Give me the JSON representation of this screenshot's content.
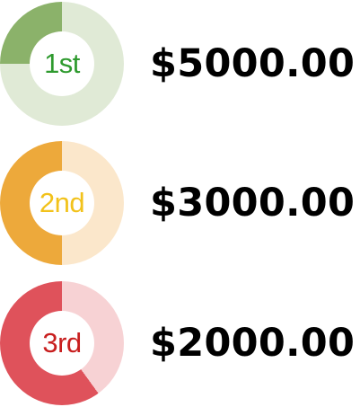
{
  "prizes": [
    {
      "place": "1st",
      "amount": "$5000.00",
      "progress": 0.25,
      "colors": {
        "fill": "#8bb26a",
        "track": "#e0ead6",
        "label": "#2e9a2e"
      }
    },
    {
      "place": "2nd",
      "amount": "$3000.00",
      "progress": 0.5,
      "colors": {
        "fill": "#eda93b",
        "track": "#fbe7cb",
        "label": "#f2c21b"
      }
    },
    {
      "place": "3rd",
      "amount": "$2000.00",
      "progress": 0.6,
      "colors": {
        "fill": "#df525b",
        "track": "#f7d2d4",
        "label": "#c81e1e"
      }
    }
  ]
}
